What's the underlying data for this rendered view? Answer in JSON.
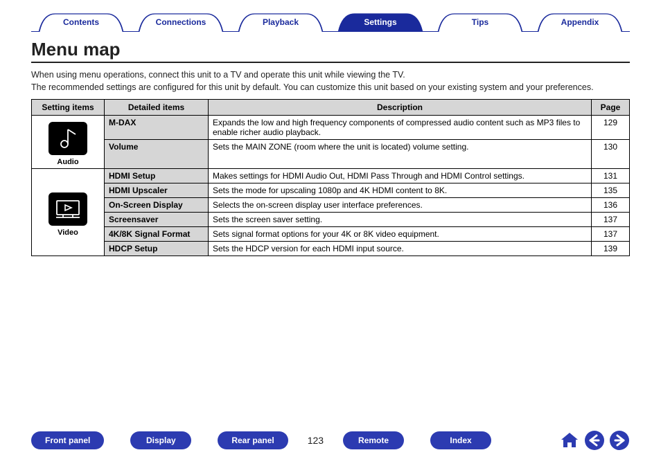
{
  "top_tabs": {
    "contents": "Contents",
    "connections": "Connections",
    "playback": "Playback",
    "settings": "Settings",
    "tips": "Tips",
    "appendix": "Appendix",
    "active": "settings"
  },
  "heading": "Menu map",
  "intro_line1": "When using menu operations, connect this unit to a TV and operate this unit while viewing the TV.",
  "intro_line2": "The recommended settings are configured for this unit by default. You can customize this unit based on your existing system and your preferences.",
  "table": {
    "headers": {
      "setting_items": "Setting items",
      "detailed_items": "Detailed items",
      "description": "Description",
      "page": "Page"
    },
    "groups": [
      {
        "name": "Audio",
        "rows": [
          {
            "item": "M-DAX",
            "desc": "Expands the low and high frequency components of compressed audio content such as MP3 files to enable richer audio playback.",
            "page": "129"
          },
          {
            "item": "Volume",
            "desc": "Sets the MAIN ZONE (room where the unit is located) volume setting.",
            "page": "130"
          }
        ]
      },
      {
        "name": "Video",
        "rows": [
          {
            "item": "HDMI Setup",
            "desc": "Makes settings for HDMI Audio Out, HDMI Pass Through and HDMI Control settings.",
            "page": "131"
          },
          {
            "item": "HDMI Upscaler",
            "desc": "Sets the mode for upscaling 1080p and 4K HDMI content to 8K.",
            "page": "135"
          },
          {
            "item": "On-Screen Display",
            "desc": "Selects the on-screen display user interface preferences.",
            "page": "136"
          },
          {
            "item": "Screensaver",
            "desc": "Sets the screen saver setting.",
            "page": "137"
          },
          {
            "item": "4K/8K Signal Format",
            "desc": "Sets signal format options for your 4K or 8K video equipment.",
            "page": "137"
          },
          {
            "item": "HDCP Setup",
            "desc": "Sets the HDCP version for each HDMI input source.",
            "page": "139"
          }
        ]
      }
    ]
  },
  "bottom": {
    "front_panel": "Front panel",
    "display": "Display",
    "rear_panel": "Rear panel",
    "remote": "Remote",
    "index": "Index",
    "page_number": "123"
  }
}
